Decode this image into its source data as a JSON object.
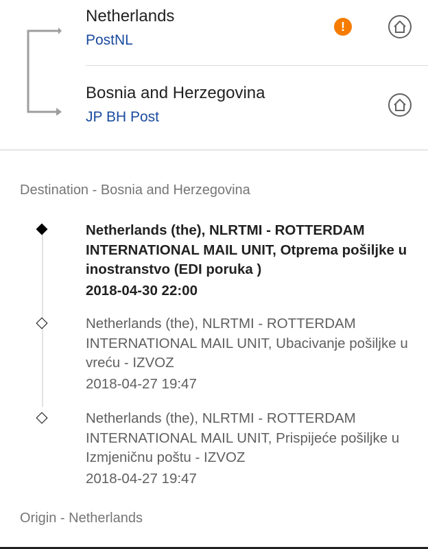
{
  "route": {
    "carriers": [
      {
        "country": "Netherlands",
        "carrier": "PostNL",
        "has_alert": true,
        "alert_glyph": "!",
        "alert_color": "#f57c00"
      },
      {
        "country": "Bosnia and Herzegovina",
        "carrier": "JP BH Post",
        "has_alert": false
      }
    ],
    "carrier_link_color": "#1a4a9e"
  },
  "destination_section": {
    "title": "Destination - Bosnia and Herzegovina",
    "events": [
      {
        "description": "Netherlands (the), NLRTMI - ROTTERDAM INTERNATIONAL MAIL UNIT, Otprema pošiljke u inostranstvo (EDI poruka )",
        "date": "2018-04-30 22:00",
        "current": true
      },
      {
        "description": "Netherlands (the), NLRTMI - ROTTERDAM INTERNATIONAL MAIL UNIT, Ubacivanje pošiljke u vreću - IZVOZ",
        "date": "2018-04-27 19:47",
        "current": false
      },
      {
        "description": "Netherlands (the), NLRTMI - ROTTERDAM INTERNATIONAL MAIL UNIT, Prispijeće pošiljke u Izmjeničnu poštu - IZVOZ",
        "date": "2018-04-27 19:47",
        "current": false
      }
    ]
  },
  "origin_section": {
    "title": "Origin - Netherlands"
  }
}
